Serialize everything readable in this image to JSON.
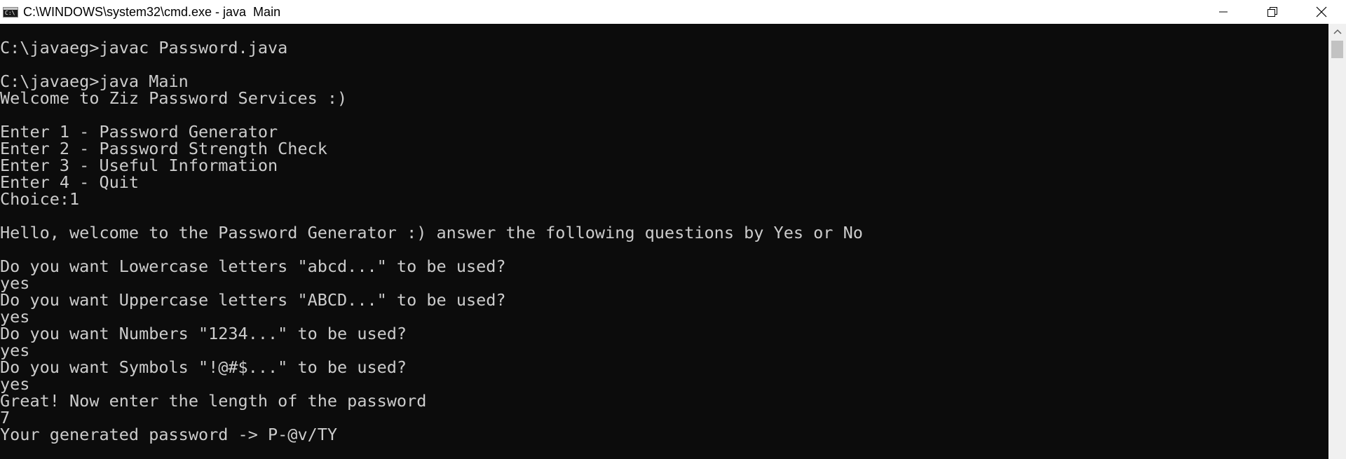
{
  "window": {
    "title": "C:\\WINDOWS\\system32\\cmd.exe - java  Main",
    "icon": "cmd-icon",
    "icon_glyph": "C:\\",
    "controls": {
      "minimize": "minimize-icon",
      "restore": "restore-icon",
      "close": "close-icon"
    }
  },
  "console": {
    "lines": [
      "",
      "C:\\javaeg>javac Password.java",
      "",
      "C:\\javaeg>java Main",
      "Welcome to Ziz Password Services :)",
      "",
      "Enter 1 - Password Generator",
      "Enter 2 - Password Strength Check",
      "Enter 3 - Useful Information",
      "Enter 4 - Quit",
      "Choice:1",
      "",
      "Hello, welcome to the Password Generator :) answer the following questions by Yes or No",
      "",
      "Do you want Lowercase letters \"abcd...\" to be used?",
      "yes",
      "Do you want Uppercase letters \"ABCD...\" to be used?",
      "yes",
      "Do you want Numbers \"1234...\" to be used?",
      "yes",
      "Do you want Symbols \"!@#$...\" to be used?",
      "yes",
      "Great! Now enter the length of the password",
      "7",
      "Your generated password -> P-@v/TY"
    ]
  },
  "colors": {
    "background": "#0c0c0c",
    "text": "#cccccc",
    "titlebar": "#ffffff"
  }
}
